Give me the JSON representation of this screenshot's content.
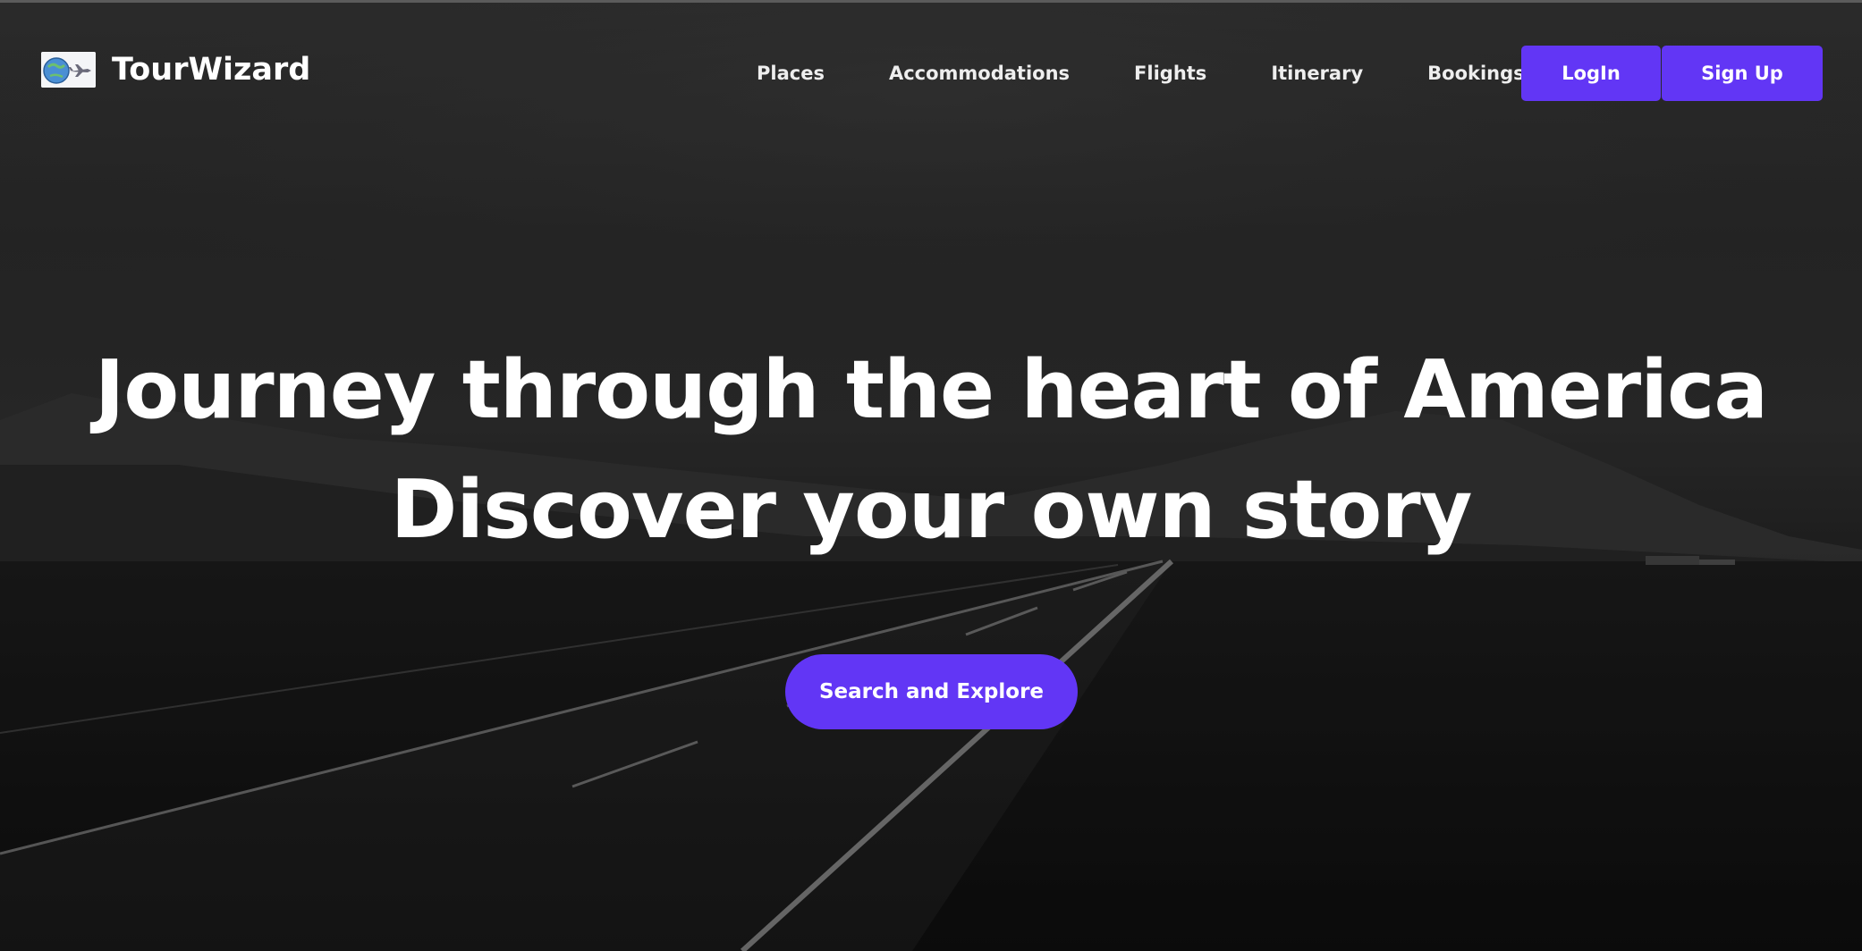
{
  "brand": {
    "name": "TourWizard",
    "logo_icon": "globe-plane-logo-icon"
  },
  "nav": {
    "links": [
      {
        "label": "Places"
      },
      {
        "label": "Accommodations"
      },
      {
        "label": "Flights"
      },
      {
        "label": "Itinerary"
      },
      {
        "label": "Bookings"
      }
    ],
    "login_label": "LogIn",
    "signup_label": "Sign Up"
  },
  "hero": {
    "headline_line1": "Journey through the heart of America",
    "headline_line2": "Discover your own story",
    "cta_label": "Search and Explore"
  },
  "colors": {
    "accent": "#6236f5",
    "text": "#ffffff",
    "overlay": "#000000"
  }
}
